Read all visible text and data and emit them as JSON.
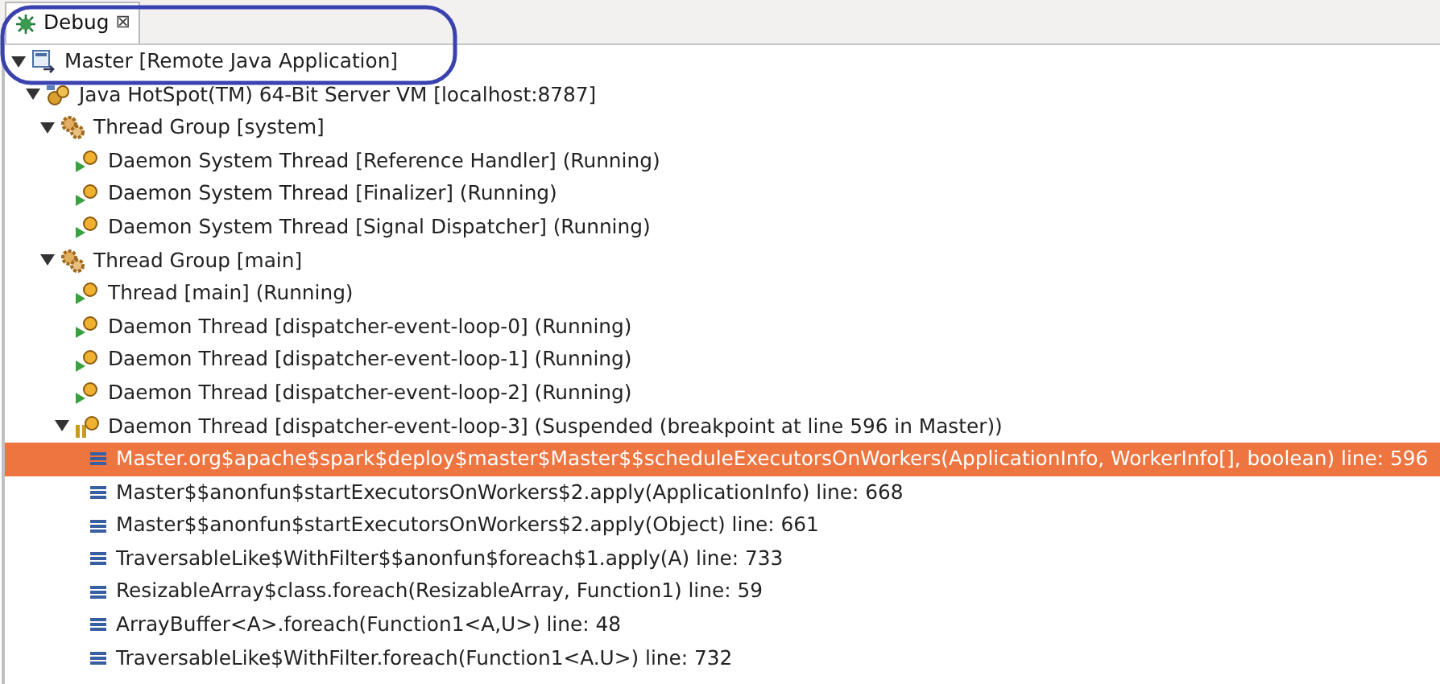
{
  "tab": {
    "title": "Debug",
    "close": "⊠",
    "selected": true
  },
  "tree": [
    {
      "kind": "launch",
      "label": "Master [Remote Java Application]",
      "expanded": true,
      "selected": false,
      "children": [
        {
          "kind": "vm",
          "label": "Java HotSpot(TM) 64-Bit Server VM [localhost:8787]",
          "expanded": true,
          "selected": false,
          "children": [
            {
              "kind": "group",
              "label": "Thread Group [system]",
              "expanded": true,
              "selected": false,
              "children": [
                {
                  "kind": "thread",
                  "suspended": false,
                  "label": "Daemon System Thread [Reference Handler] (Running)",
                  "selected": false
                },
                {
                  "kind": "thread",
                  "suspended": false,
                  "label": "Daemon System Thread [Finalizer] (Running)",
                  "selected": false
                },
                {
                  "kind": "thread",
                  "suspended": false,
                  "label": "Daemon System Thread [Signal Dispatcher] (Running)",
                  "selected": false
                }
              ]
            },
            {
              "kind": "group",
              "label": "Thread Group [main]",
              "expanded": true,
              "selected": false,
              "children": [
                {
                  "kind": "thread",
                  "suspended": false,
                  "label": "Thread [main] (Running)",
                  "selected": false
                },
                {
                  "kind": "thread",
                  "suspended": false,
                  "label": "Daemon Thread [dispatcher-event-loop-0] (Running)",
                  "selected": false
                },
                {
                  "kind": "thread",
                  "suspended": false,
                  "label": "Daemon Thread [dispatcher-event-loop-1] (Running)",
                  "selected": false
                },
                {
                  "kind": "thread",
                  "suspended": false,
                  "label": "Daemon Thread [dispatcher-event-loop-2] (Running)",
                  "selected": false
                },
                {
                  "kind": "thread",
                  "suspended": true,
                  "label": "Daemon Thread [dispatcher-event-loop-3] (Suspended (breakpoint at line 596 in Master))",
                  "expanded": true,
                  "selected": false,
                  "children": [
                    {
                      "kind": "frame",
                      "label": "Master.org$apache$spark$deploy$master$Master$$scheduleExecutorsOnWorkers(ApplicationInfo, WorkerInfo[], boolean) line: 596",
                      "selected": true
                    },
                    {
                      "kind": "frame",
                      "label": "Master$$anonfun$startExecutorsOnWorkers$2.apply(ApplicationInfo) line: 668",
                      "selected": false
                    },
                    {
                      "kind": "frame",
                      "label": "Master$$anonfun$startExecutorsOnWorkers$2.apply(Object) line: 661",
                      "selected": false
                    },
                    {
                      "kind": "frame",
                      "label": "TraversableLike$WithFilter$$anonfun$foreach$1.apply(A) line: 733",
                      "selected": false
                    },
                    {
                      "kind": "frame",
                      "label": "ResizableArray$class.foreach(ResizableArray, Function1) line: 59",
                      "selected": false
                    },
                    {
                      "kind": "frame",
                      "label": "ArrayBuffer<A>.foreach(Function1<A,U>) line: 48",
                      "selected": false
                    },
                    {
                      "kind": "frame",
                      "label": "TraversableLike$WithFilter.foreach(Function1<A.U>) line: 732",
                      "selected": false
                    }
                  ]
                }
              ]
            }
          ]
        }
      ]
    }
  ]
}
